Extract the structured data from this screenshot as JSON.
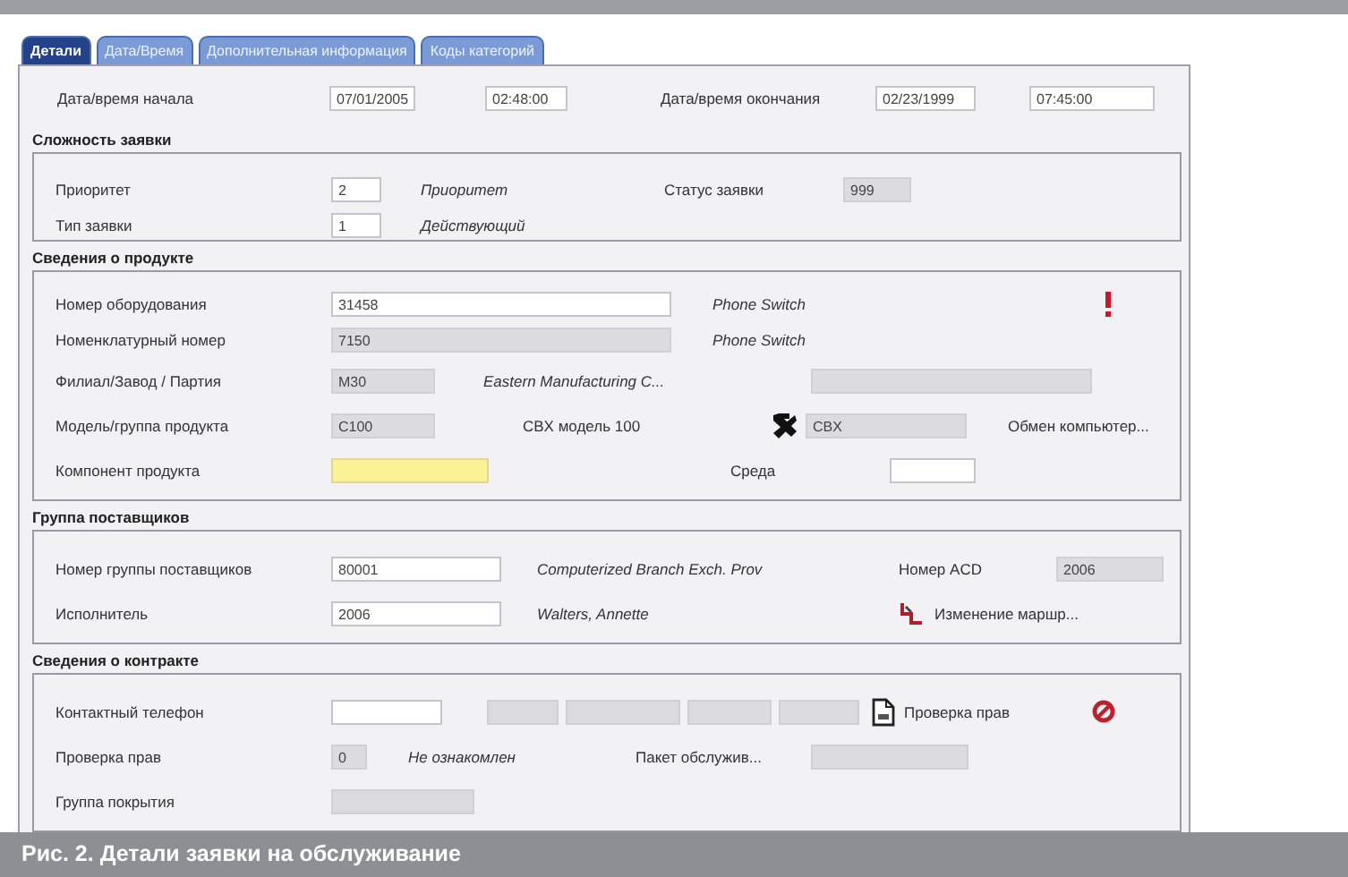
{
  "tabs": [
    {
      "label": "Детали",
      "selected": true
    },
    {
      "label": "Дата/Время",
      "selected": false
    },
    {
      "label": "Дополнительная информация",
      "selected": false
    },
    {
      "label": "Коды категорий",
      "selected": false
    }
  ],
  "header": {
    "start_label": "Дата/время начала",
    "start_date": {
      "value": "07/01/2005",
      "disabled": false,
      "highlighted": false
    },
    "start_time": {
      "value": "02:48:00",
      "disabled": false,
      "highlighted": false
    },
    "end_label": "Дата/время окончания",
    "end_date": {
      "value": "02/23/1999",
      "disabled": false,
      "highlighted": false
    },
    "end_time": {
      "value": "07:45:00",
      "disabled": false,
      "highlighted": false
    }
  },
  "complexity": {
    "title": "Сложность заявки",
    "priority_label": "Приоритет",
    "priority": {
      "value": "2",
      "disabled": false,
      "highlighted": false
    },
    "priority_text": "Приоритет",
    "status_label": "Статус заявки",
    "status": {
      "value": "999",
      "disabled": true,
      "highlighted": false
    },
    "type_label": "Тип заявки",
    "type": {
      "value": "1",
      "disabled": false,
      "highlighted": false
    },
    "type_text": "Действующий"
  },
  "product": {
    "title": "Сведения о продукте",
    "equipment_label": "Номер оборудования",
    "equipment": {
      "value": "31458",
      "disabled": false,
      "highlighted": false
    },
    "equipment_text": "Phone Switch",
    "nomenclature_label": "Номенклатурный номер",
    "nomenclature": {
      "value": "7150",
      "disabled": true,
      "highlighted": false
    },
    "nomenclature_text": "Phone Switch",
    "branch_label": "Филиал/Завод / Партия",
    "branch": {
      "value": "M30",
      "disabled": true,
      "highlighted": false
    },
    "branch_text": "Eastern Manufacturing C...",
    "branch_extra": {
      "disabled": true,
      "highlighted": false
    },
    "model_label": "Модель/группа продукта",
    "model": {
      "value": "C100",
      "disabled": true,
      "highlighted": false
    },
    "model_text": "CBX модель 100",
    "model_code": {
      "value": "CBX",
      "disabled": true,
      "highlighted": false
    },
    "model_extra_text": "Обмен компьютер...",
    "component_label": "Компонент продукта",
    "component": {
      "disabled": false,
      "highlighted": true
    },
    "environment_label": "Среда",
    "environment": {
      "disabled": false,
      "highlighted": false
    }
  },
  "suppliers": {
    "title": "Группа поставщиков",
    "group_label": "Номер группы поставщиков",
    "group": {
      "value": "80001",
      "disabled": false,
      "highlighted": false
    },
    "group_text": "Computerized Branch Exch. Prov",
    "acd_label": "Номер ACD",
    "acd": {
      "value": "2006",
      "disabled": true,
      "highlighted": false
    },
    "executor_label": "Исполнитель",
    "executor": {
      "value": "2006",
      "disabled": false,
      "highlighted": false
    },
    "executor_text": "Walters, Annette",
    "route_link": "Изменение маршр..."
  },
  "contract": {
    "title": "Сведения о контракте",
    "phone_label": "Контактный телефон",
    "phone": {
      "disabled": false,
      "highlighted": false
    },
    "phone_parts": [
      {
        "disabled": true,
        "highlighted": false
      },
      {
        "disabled": true,
        "highlighted": false
      },
      {
        "disabled": true,
        "highlighted": false
      },
      {
        "disabled": true,
        "highlighted": false
      }
    ],
    "check_link": "Проверка прав",
    "rights_label": "Проверка прав",
    "rights": {
      "value": "0",
      "disabled": true,
      "highlighted": false
    },
    "rights_text": "Не ознакомлен",
    "package_label": "Пакет обслужив...",
    "package": {
      "disabled": true,
      "highlighted": false
    },
    "coverage_label": "Группа покрытия",
    "coverage": {
      "disabled": true,
      "highlighted": false
    }
  },
  "caption": "Рис. 2. Детали заявки на обслуживание"
}
